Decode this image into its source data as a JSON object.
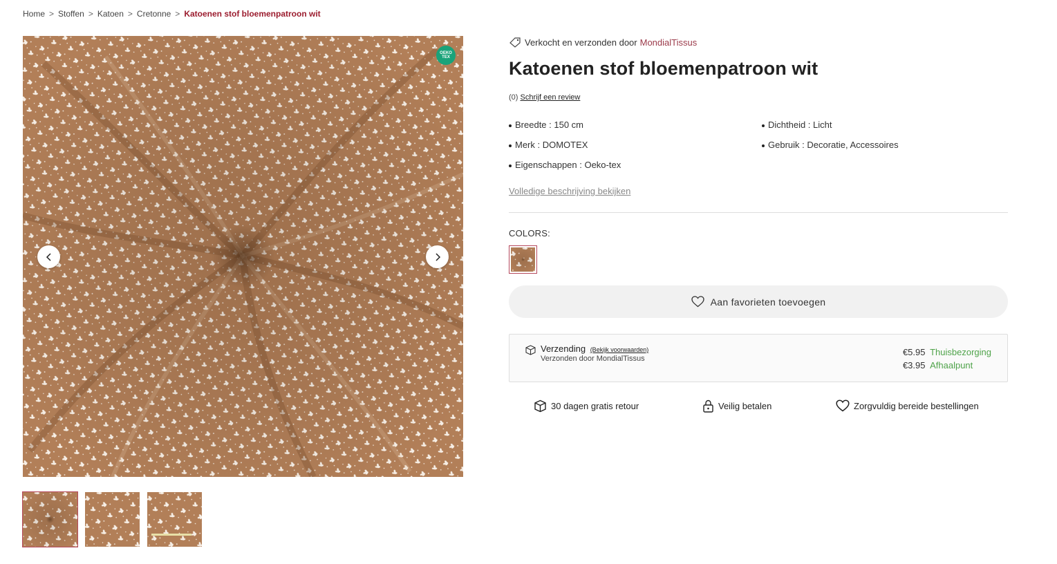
{
  "breadcrumb": {
    "items": [
      "Home",
      "Stoffen",
      "Katoen",
      "Cretonne"
    ],
    "separator": ">",
    "current": "Katoenen stof bloemenpatroon wit"
  },
  "gallery": {
    "badge": "OEKO TEX",
    "prev_icon": "chevron-left-icon",
    "next_icon": "chevron-right-icon",
    "thumbnail_count": 3
  },
  "product": {
    "seller_prefix": "Verkocht en verzonden door",
    "seller_name": "MondialTissus",
    "title": "Katoenen stof bloemenpatroon wit",
    "review_count": "(0)",
    "review_link": "Schrijf een review",
    "specs": [
      "Breedte : 150 cm",
      "Dichtheid : Licht",
      "Merk : DOMOTEX",
      "Gebruik : Decoratie, Accessoires",
      "Eigenschappen : Oeko-tex"
    ],
    "full_description_link": "Volledige beschrijving bekijken",
    "colors_label": "COLORS:",
    "favorite_button": "Aan favorieten toevoegen"
  },
  "shipping": {
    "title": "Verzending",
    "conditions_link": "(Bekijk voorwaarden)",
    "subtitle": "Verzonden door MondialTissus",
    "options": [
      {
        "price": "€5.95",
        "label": "Thuisbezorging"
      },
      {
        "price": "€3.95",
        "label": "Afhaalpunt"
      }
    ]
  },
  "badges": [
    {
      "icon": "box-icon",
      "label": "30 dagen gratis retour"
    },
    {
      "icon": "lock-icon",
      "label": "Veilig betalen"
    },
    {
      "icon": "heart-icon",
      "label": "Zorgvuldig bereide bestellingen"
    }
  ],
  "colors": {
    "brand": "#9b1c2e",
    "fabric": "#b27f58",
    "green": "#4fa34a"
  }
}
